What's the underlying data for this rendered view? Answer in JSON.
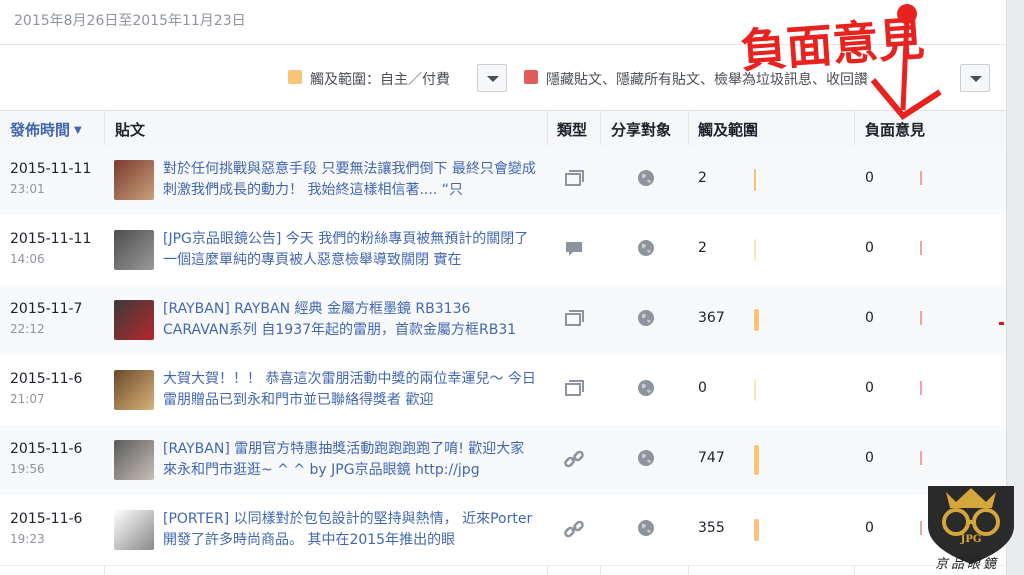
{
  "date_range": "2015年8月26日至2015年11月23日",
  "filters": {
    "reach_label": "觸及範圍：自主／付費",
    "reach_color": "#f7c479",
    "negative_label": "隱藏貼文、隱藏所有貼文、檢舉為垃圾訊息、收回讚",
    "negative_color": "#e05d5d"
  },
  "columns": {
    "published": "發佈時間",
    "post": "貼文",
    "type": "類型",
    "targeting": "分享對象",
    "reach": "觸及範圍",
    "negative": "負面意見"
  },
  "annotation": "負面意見",
  "rows": [
    {
      "date": "2015-11-11",
      "time": "23:01",
      "text": "對於任何挑戰與惡意手段 只要無法讓我們倒下 最終只會變成刺激我們成長的動力！ 我始終這樣相信著.... “只",
      "type": "photo",
      "reach": "2",
      "reach_fraction": 0.04,
      "negative": "0"
    },
    {
      "date": "2015-11-11",
      "time": "14:06",
      "text": "[JPG京品眼鏡公告] 今天 我們的粉絲專頁被無預計的關閉了 一個這麼單純的專頁被人惡意檢舉導致關閉 實在",
      "type": "status",
      "reach": "2",
      "reach_fraction": 0.0,
      "negative": "0"
    },
    {
      "date": "2015-11-7",
      "time": "22:12",
      "text": "[RAYBAN] RAYBAN 經典 金屬方框墨鏡 RB3136 CARAVAN系列 自1937年起的雷朋，首款金屬方框RB31",
      "type": "photo",
      "reach": "367",
      "reach_fraction": 0.49,
      "negative": "0"
    },
    {
      "date": "2015-11-6",
      "time": "21:07",
      "text": "大賀大賀！！！ 恭喜這次雷朋活動中獎的兩位幸運兒～ 今日雷朋贈品已到永和門市並已聯絡得獎者 歡迎",
      "type": "photo",
      "reach": "0",
      "reach_fraction": 0.0,
      "negative": "0"
    },
    {
      "date": "2015-11-6",
      "time": "19:56",
      "text": "[RAYBAN] 雷朋官方特惠抽獎活動跑跑跑跑了唷! 歡迎大家來永和門市逛逛~ ^ ^ by JPG京品眼鏡 http://jpg",
      "type": "link",
      "reach": "747",
      "reach_fraction": 1.0,
      "negative": "0"
    },
    {
      "date": "2015-11-6",
      "time": "19:23",
      "text": "[PORTER] 以同樣對於包包設計的堅持與熱情， 近來Porter開發了許多時尚商品。 其中在2015年推出的眼",
      "type": "link",
      "reach": "355",
      "reach_fraction": 0.48,
      "negative": "0"
    }
  ],
  "logo_text": "京品眼鏡",
  "logo_badge": "JPG"
}
